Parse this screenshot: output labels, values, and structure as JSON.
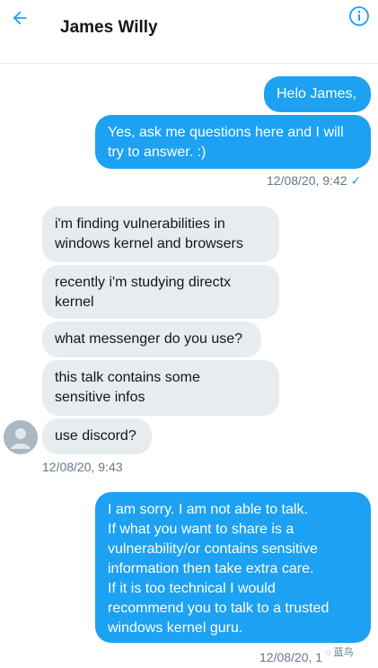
{
  "header": {
    "title": "James Willy"
  },
  "messages": {
    "out1": "Helo James,",
    "out2_line1": "Yes, ask me questions here and I will",
    "out2_line2": "try to answer. :)",
    "stamp1": "12/08/20, 9:42",
    "in1_line1": "i'm finding vulnerabilities in",
    "in1_line2": "windows kernel and browsers",
    "in2_line1": "recently i'm studying directx",
    "in2_line2": "kernel",
    "in3": "what messenger do you use?",
    "in4_line1": "this talk contains some",
    "in4_line2": "sensitive infos",
    "in5": "use discord?",
    "stamp2": "12/08/20, 9:43",
    "out3_lines": [
      "I am sorry. I am not able to talk.",
      "If what you want to share is a",
      "vulnerability/or contains sensitive",
      "information then take extra care.",
      "If it is too technical I would",
      "recommend you to talk to a trusted",
      "windows kernel guru."
    ],
    "stamp3": "12/08/20, 1"
  },
  "watermark": "蓝鸟"
}
